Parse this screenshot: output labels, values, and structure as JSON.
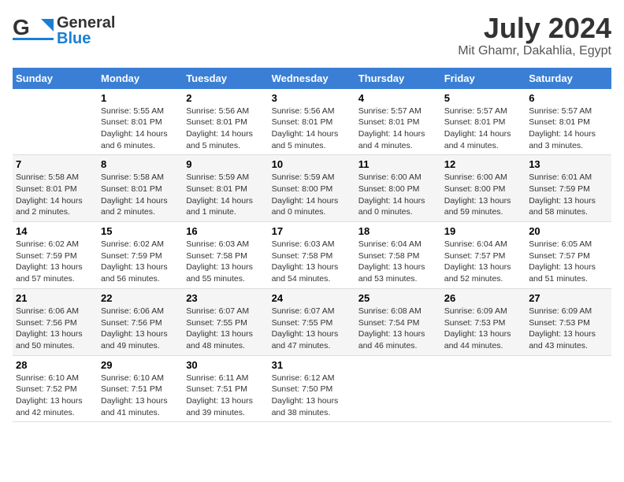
{
  "header": {
    "logo": {
      "line1": "General",
      "line2": "Blue",
      "alt": "GeneralBlue"
    },
    "title": "July 2024",
    "subtitle": "Mit Ghamr, Dakahlia, Egypt"
  },
  "columns": [
    "Sunday",
    "Monday",
    "Tuesday",
    "Wednesday",
    "Thursday",
    "Friday",
    "Saturday"
  ],
  "weeks": [
    {
      "days": [
        {
          "number": "",
          "info": ""
        },
        {
          "number": "1",
          "info": "Sunrise: 5:55 AM\nSunset: 8:01 PM\nDaylight: 14 hours\nand 6 minutes."
        },
        {
          "number": "2",
          "info": "Sunrise: 5:56 AM\nSunset: 8:01 PM\nDaylight: 14 hours\nand 5 minutes."
        },
        {
          "number": "3",
          "info": "Sunrise: 5:56 AM\nSunset: 8:01 PM\nDaylight: 14 hours\nand 5 minutes."
        },
        {
          "number": "4",
          "info": "Sunrise: 5:57 AM\nSunset: 8:01 PM\nDaylight: 14 hours\nand 4 minutes."
        },
        {
          "number": "5",
          "info": "Sunrise: 5:57 AM\nSunset: 8:01 PM\nDaylight: 14 hours\nand 4 minutes."
        },
        {
          "number": "6",
          "info": "Sunrise: 5:57 AM\nSunset: 8:01 PM\nDaylight: 14 hours\nand 3 minutes."
        }
      ]
    },
    {
      "days": [
        {
          "number": "7",
          "info": "Sunrise: 5:58 AM\nSunset: 8:01 PM\nDaylight: 14 hours\nand 2 minutes."
        },
        {
          "number": "8",
          "info": "Sunrise: 5:58 AM\nSunset: 8:01 PM\nDaylight: 14 hours\nand 2 minutes."
        },
        {
          "number": "9",
          "info": "Sunrise: 5:59 AM\nSunset: 8:01 PM\nDaylight: 14 hours\nand 1 minute."
        },
        {
          "number": "10",
          "info": "Sunrise: 5:59 AM\nSunset: 8:00 PM\nDaylight: 14 hours\nand 0 minutes."
        },
        {
          "number": "11",
          "info": "Sunrise: 6:00 AM\nSunset: 8:00 PM\nDaylight: 14 hours\nand 0 minutes."
        },
        {
          "number": "12",
          "info": "Sunrise: 6:00 AM\nSunset: 8:00 PM\nDaylight: 13 hours\nand 59 minutes."
        },
        {
          "number": "13",
          "info": "Sunrise: 6:01 AM\nSunset: 7:59 PM\nDaylight: 13 hours\nand 58 minutes."
        }
      ]
    },
    {
      "days": [
        {
          "number": "14",
          "info": "Sunrise: 6:02 AM\nSunset: 7:59 PM\nDaylight: 13 hours\nand 57 minutes."
        },
        {
          "number": "15",
          "info": "Sunrise: 6:02 AM\nSunset: 7:59 PM\nDaylight: 13 hours\nand 56 minutes."
        },
        {
          "number": "16",
          "info": "Sunrise: 6:03 AM\nSunset: 7:58 PM\nDaylight: 13 hours\nand 55 minutes."
        },
        {
          "number": "17",
          "info": "Sunrise: 6:03 AM\nSunset: 7:58 PM\nDaylight: 13 hours\nand 54 minutes."
        },
        {
          "number": "18",
          "info": "Sunrise: 6:04 AM\nSunset: 7:58 PM\nDaylight: 13 hours\nand 53 minutes."
        },
        {
          "number": "19",
          "info": "Sunrise: 6:04 AM\nSunset: 7:57 PM\nDaylight: 13 hours\nand 52 minutes."
        },
        {
          "number": "20",
          "info": "Sunrise: 6:05 AM\nSunset: 7:57 PM\nDaylight: 13 hours\nand 51 minutes."
        }
      ]
    },
    {
      "days": [
        {
          "number": "21",
          "info": "Sunrise: 6:06 AM\nSunset: 7:56 PM\nDaylight: 13 hours\nand 50 minutes."
        },
        {
          "number": "22",
          "info": "Sunrise: 6:06 AM\nSunset: 7:56 PM\nDaylight: 13 hours\nand 49 minutes."
        },
        {
          "number": "23",
          "info": "Sunrise: 6:07 AM\nSunset: 7:55 PM\nDaylight: 13 hours\nand 48 minutes."
        },
        {
          "number": "24",
          "info": "Sunrise: 6:07 AM\nSunset: 7:55 PM\nDaylight: 13 hours\nand 47 minutes."
        },
        {
          "number": "25",
          "info": "Sunrise: 6:08 AM\nSunset: 7:54 PM\nDaylight: 13 hours\nand 46 minutes."
        },
        {
          "number": "26",
          "info": "Sunrise: 6:09 AM\nSunset: 7:53 PM\nDaylight: 13 hours\nand 44 minutes."
        },
        {
          "number": "27",
          "info": "Sunrise: 6:09 AM\nSunset: 7:53 PM\nDaylight: 13 hours\nand 43 minutes."
        }
      ]
    },
    {
      "days": [
        {
          "number": "28",
          "info": "Sunrise: 6:10 AM\nSunset: 7:52 PM\nDaylight: 13 hours\nand 42 minutes."
        },
        {
          "number": "29",
          "info": "Sunrise: 6:10 AM\nSunset: 7:51 PM\nDaylight: 13 hours\nand 41 minutes."
        },
        {
          "number": "30",
          "info": "Sunrise: 6:11 AM\nSunset: 7:51 PM\nDaylight: 13 hours\nand 39 minutes."
        },
        {
          "number": "31",
          "info": "Sunrise: 6:12 AM\nSunset: 7:50 PM\nDaylight: 13 hours\nand 38 minutes."
        },
        {
          "number": "",
          "info": ""
        },
        {
          "number": "",
          "info": ""
        },
        {
          "number": "",
          "info": ""
        }
      ]
    }
  ]
}
